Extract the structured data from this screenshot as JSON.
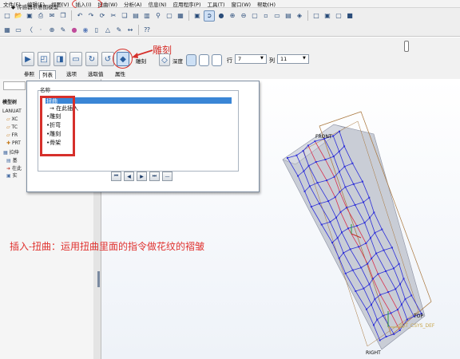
{
  "menubar": {
    "items": [
      "文件(F)",
      "编辑(E)",
      "视图(V)",
      "插入(I)",
      "扭曲(W)",
      "分析(A)",
      "信息(N)",
      "应用程序(P)",
      "工具(T)",
      "窗口(W)",
      "帮助(H)"
    ]
  },
  "dashboard": {
    "title": "◆ 传感器示意图模型",
    "bianqu_label": "雕刻",
    "zuoche_label": "雕刻",
    "tuzhi_label": "深度",
    "row_label": "行",
    "row_value": "7",
    "col_label": "列",
    "col_value": "11",
    "tabs": [
      "参照",
      "列表",
      "选项",
      "选取值",
      "属性"
    ]
  },
  "model_tree": {
    "header": "模型树",
    "rows": [
      "LANUAT",
      "XC",
      "TC",
      "FR",
      "PRT",
      "拉伸",
      "基",
      "在此",
      "实"
    ]
  },
  "popup": {
    "header": "名称",
    "items": [
      {
        "label": "扭曲",
        "selected": true
      },
      {
        "label": "→ 在此插入",
        "selected": false
      },
      {
        "label": "•雕刻",
        "selected": false
      },
      {
        "label": "•折弯",
        "selected": false
      },
      {
        "label": "•雕刻",
        "selected": false
      },
      {
        "label": "•骨架",
        "selected": false
      }
    ],
    "nav": [
      "⏮",
      "◀",
      "▶",
      "⏭",
      "—"
    ]
  },
  "annotation": "插入-扭曲：运用扭曲里面的指令做花纹的褶皱",
  "model_labels": {
    "front": "FRONT",
    "top": "TOP",
    "right": "RIGHT",
    "csys": "PRT_CSYS_DEF"
  },
  "colors": {
    "accent_red": "#d6302b",
    "mesh_blue": "#2d2fd8",
    "mesh_red": "#d8304e",
    "selection": "#3a86d6"
  }
}
